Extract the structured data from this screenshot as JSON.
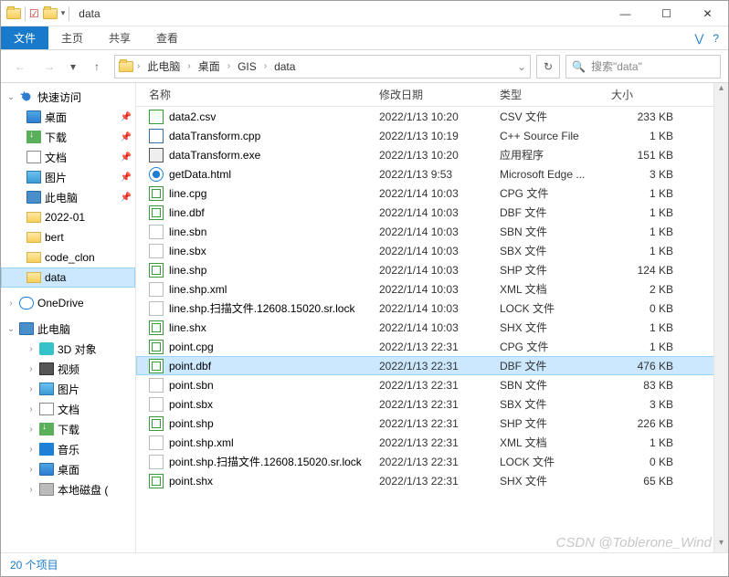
{
  "window": {
    "title": "data",
    "minimize": "—",
    "maximize": "☐",
    "close": "✕"
  },
  "ribbon": {
    "file": "文件",
    "home": "主页",
    "share": "共享",
    "view": "查看",
    "help": "?"
  },
  "breadcrumb": {
    "items": [
      "此电脑",
      "桌面",
      "GIS",
      "data"
    ]
  },
  "search": {
    "placeholder": "搜索\"data\""
  },
  "sidebar": {
    "quick": {
      "label": "快速访问",
      "items": [
        {
          "label": "桌面",
          "icon": "i-desktop",
          "pin": true
        },
        {
          "label": "下载",
          "icon": "i-download",
          "pin": true
        },
        {
          "label": "文档",
          "icon": "i-doc",
          "pin": true
        },
        {
          "label": "图片",
          "icon": "i-pic",
          "pin": true
        },
        {
          "label": "此电脑",
          "icon": "i-pc",
          "pin": true
        },
        {
          "label": "2022-01",
          "icon": "i-folder",
          "pin": false
        },
        {
          "label": "bert",
          "icon": "i-folder",
          "pin": false
        },
        {
          "label": "code_clon",
          "icon": "i-folder",
          "pin": false
        },
        {
          "label": "data",
          "icon": "i-folder",
          "pin": false,
          "selected": true
        }
      ]
    },
    "onedrive": {
      "label": "OneDrive"
    },
    "thispc": {
      "label": "此电脑",
      "items": [
        {
          "label": "3D 对象",
          "icon": "i-3d"
        },
        {
          "label": "视频",
          "icon": "i-video"
        },
        {
          "label": "图片",
          "icon": "i-pic"
        },
        {
          "label": "文档",
          "icon": "i-doc"
        },
        {
          "label": "下载",
          "icon": "i-download"
        },
        {
          "label": "音乐",
          "icon": "i-music"
        },
        {
          "label": "桌面",
          "icon": "i-desktop"
        },
        {
          "label": "本地磁盘 (",
          "icon": "i-disk"
        }
      ]
    }
  },
  "columns": {
    "name": "名称",
    "date": "修改日期",
    "type": "类型",
    "size": "大小"
  },
  "files": [
    {
      "name": "data2.csv",
      "date": "2022/1/13 10:20",
      "type": "CSV 文件",
      "size": "233 KB",
      "icon": "csv"
    },
    {
      "name": "dataTransform.cpp",
      "date": "2022/1/13 10:19",
      "type": "C++ Source File",
      "size": "1 KB",
      "icon": "cpp"
    },
    {
      "name": "dataTransform.exe",
      "date": "2022/1/13 10:20",
      "type": "应用程序",
      "size": "151 KB",
      "icon": "exe"
    },
    {
      "name": "getData.html",
      "date": "2022/1/13 9:53",
      "type": "Microsoft Edge ...",
      "size": "3 KB",
      "icon": "html"
    },
    {
      "name": "line.cpg",
      "date": "2022/1/14 10:03",
      "type": "CPG 文件",
      "size": "1 KB",
      "icon": "green"
    },
    {
      "name": "line.dbf",
      "date": "2022/1/14 10:03",
      "type": "DBF 文件",
      "size": "1 KB",
      "icon": "green"
    },
    {
      "name": "line.sbn",
      "date": "2022/1/14 10:03",
      "type": "SBN 文件",
      "size": "1 KB",
      "icon": "blank"
    },
    {
      "name": "line.sbx",
      "date": "2022/1/14 10:03",
      "type": "SBX 文件",
      "size": "1 KB",
      "icon": "blank"
    },
    {
      "name": "line.shp",
      "date": "2022/1/14 10:03",
      "type": "SHP 文件",
      "size": "124 KB",
      "icon": "green"
    },
    {
      "name": "line.shp.xml",
      "date": "2022/1/14 10:03",
      "type": "XML 文档",
      "size": "2 KB",
      "icon": "blank"
    },
    {
      "name": "line.shp.扫描文件.12608.15020.sr.lock",
      "date": "2022/1/14 10:03",
      "type": "LOCK 文件",
      "size": "0 KB",
      "icon": "blank"
    },
    {
      "name": "line.shx",
      "date": "2022/1/14 10:03",
      "type": "SHX 文件",
      "size": "1 KB",
      "icon": "green"
    },
    {
      "name": "point.cpg",
      "date": "2022/1/13 22:31",
      "type": "CPG 文件",
      "size": "1 KB",
      "icon": "green"
    },
    {
      "name": "point.dbf",
      "date": "2022/1/13 22:31",
      "type": "DBF 文件",
      "size": "476 KB",
      "icon": "green",
      "selected": true
    },
    {
      "name": "point.sbn",
      "date": "2022/1/13 22:31",
      "type": "SBN 文件",
      "size": "83 KB",
      "icon": "blank"
    },
    {
      "name": "point.sbx",
      "date": "2022/1/13 22:31",
      "type": "SBX 文件",
      "size": "3 KB",
      "icon": "blank"
    },
    {
      "name": "point.shp",
      "date": "2022/1/13 22:31",
      "type": "SHP 文件",
      "size": "226 KB",
      "icon": "green"
    },
    {
      "name": "point.shp.xml",
      "date": "2022/1/13 22:31",
      "type": "XML 文档",
      "size": "1 KB",
      "icon": "blank"
    },
    {
      "name": "point.shp.扫描文件.12608.15020.sr.lock",
      "date": "2022/1/13 22:31",
      "type": "LOCK 文件",
      "size": "0 KB",
      "icon": "blank"
    },
    {
      "name": "point.shx",
      "date": "2022/1/13 22:31",
      "type": "SHX 文件",
      "size": "65 KB",
      "icon": "green"
    }
  ],
  "status": {
    "count": "20 个项目"
  },
  "watermark": "CSDN @Toblerone_Wind"
}
